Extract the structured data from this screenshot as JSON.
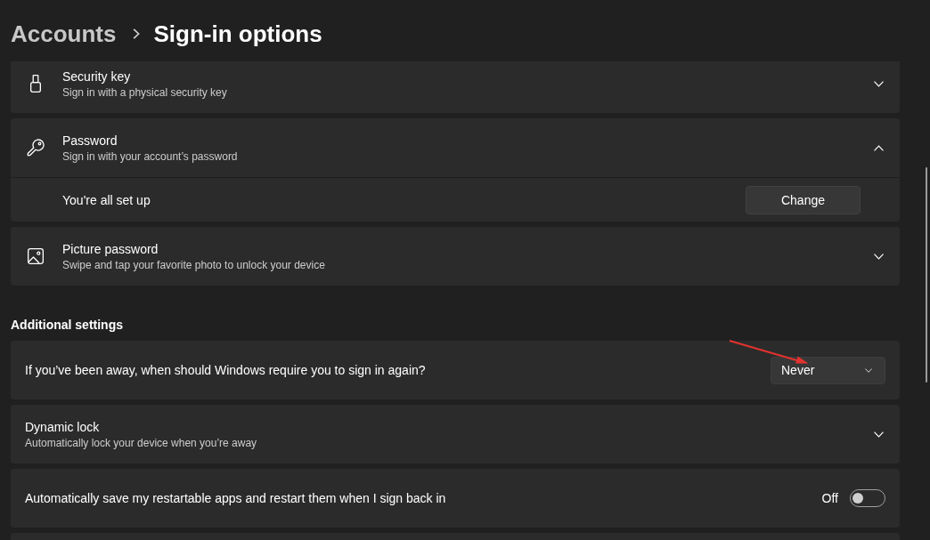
{
  "breadcrumb": {
    "parent": "Accounts",
    "current": "Sign-in options"
  },
  "sign_in_methods": [
    {
      "title": "Security key",
      "description": "Sign in with a physical security key",
      "expanded": false
    },
    {
      "title": "Password",
      "description": "Sign in with your account’s password",
      "expanded": true,
      "details": [
        {
          "label": "You're all set up",
          "button": "Change"
        }
      ]
    },
    {
      "title": "Picture password",
      "description": "Swipe and tap your favorite photo to unlock your device",
      "expanded": false
    }
  ],
  "additional_settings": {
    "heading": "Additional settings",
    "items": [
      {
        "kind": "dropdown",
        "label": "If you’ve been away, when should Windows require you to sign in again?",
        "value": "Never"
      },
      {
        "kind": "expander",
        "title": "Dynamic lock",
        "description": "Automatically lock your device when you’re away",
        "expanded": false
      },
      {
        "kind": "toggle",
        "label": "Automatically save my restartable apps and restart them when I sign back in",
        "on": false,
        "state_text": "Off"
      }
    ]
  },
  "annotations": [
    {
      "kind": "arrow"
    }
  ]
}
